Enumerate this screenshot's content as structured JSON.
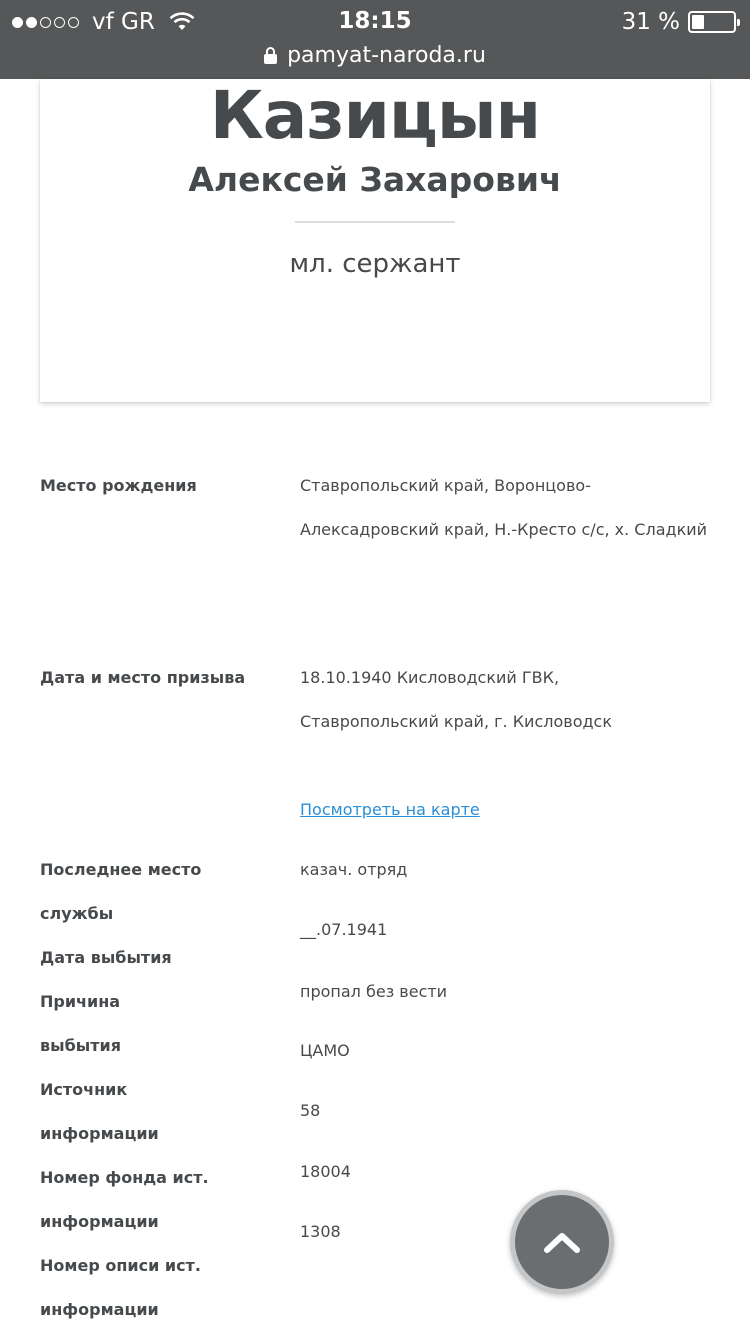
{
  "status_bar": {
    "carrier": "vf GR",
    "time": "18:15",
    "battery": "31 %",
    "battery_level": 0.31,
    "url": "pamyat-naroda.ru"
  },
  "person": {
    "surname": "Казицын",
    "given_names": "Алексей Захарович",
    "rank": "мл. сержант"
  },
  "details": {
    "birth_place_label": "Место рождения",
    "birth_place_value": "Ставропольский край, Воронцово-Алексадровский край, Н.-Кресто с/с, х. Сладкий",
    "draft_label": "Дата и место призыва",
    "draft_value": "18.10.1940 Кисловодский ГВК, Ставропольский край, г. Кисловодск",
    "map_link": "Посмотреть на карте",
    "last_service_label": "Последнее место службы",
    "last_service_value": "казач. отряд",
    "departure_date_label": "Дата выбытия",
    "departure_date_value": "__.07.1941",
    "departure_reason_label": "Причина выбытия",
    "departure_reason_value": "пропал без вести",
    "source_label": "Источник информации",
    "source_value": "ЦАМО",
    "fond_label": "Номер фонда ист. информации",
    "fond_value": "58",
    "opis_label": "Номер описи ист. информации",
    "opis_value": "18004",
    "delo_value": "1308"
  },
  "icons": {
    "scroll_top": "chevron-up-icon"
  }
}
